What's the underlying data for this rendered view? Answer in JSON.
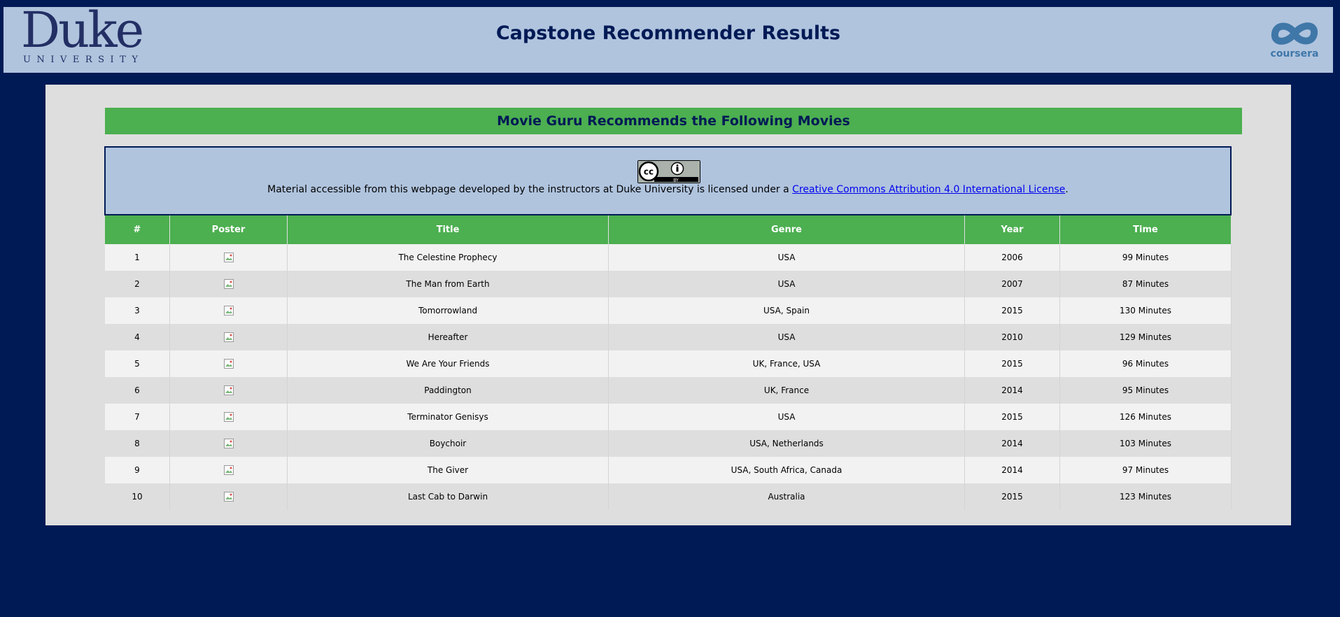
{
  "header": {
    "duke_wordmark": "Duke",
    "duke_sub": "UNIVERSITY",
    "title": "Capstone Recommender Results",
    "coursera_wordmark": "coursera"
  },
  "banner": {
    "text": "Movie Guru Recommends the Following Movies"
  },
  "license": {
    "badge": "cc-by-badge",
    "text_before": "Material accessible from this webpage developed by the instructors at Duke University is licensed under a ",
    "link_text": "Creative Commons Attribution 4.0 International License",
    "text_after": "."
  },
  "table": {
    "columns": [
      "#",
      "Poster",
      "Title",
      "Genre",
      "Year",
      "Time"
    ],
    "rows": [
      {
        "num": "1",
        "title": "The Celestine Prophecy",
        "genre": "USA",
        "year": "2006",
        "time": "99 Minutes"
      },
      {
        "num": "2",
        "title": "The Man from Earth",
        "genre": "USA",
        "year": "2007",
        "time": "87 Minutes"
      },
      {
        "num": "3",
        "title": "Tomorrowland",
        "genre": "USA, Spain",
        "year": "2015",
        "time": "130 Minutes"
      },
      {
        "num": "4",
        "title": "Hereafter",
        "genre": "USA",
        "year": "2010",
        "time": "129 Minutes"
      },
      {
        "num": "5",
        "title": "We Are Your Friends",
        "genre": "UK, France, USA",
        "year": "2015",
        "time": "96 Minutes"
      },
      {
        "num": "6",
        "title": "Paddington",
        "genre": "UK, France",
        "year": "2014",
        "time": "95 Minutes"
      },
      {
        "num": "7",
        "title": "Terminator Genisys",
        "genre": "USA",
        "year": "2015",
        "time": "126 Minutes"
      },
      {
        "num": "8",
        "title": "Boychoir",
        "genre": "USA, Netherlands",
        "year": "2014",
        "time": "103 Minutes"
      },
      {
        "num": "9",
        "title": "The Giver",
        "genre": "USA, South Africa, Canada",
        "year": "2014",
        "time": "97 Minutes"
      },
      {
        "num": "10",
        "title": "Last Cab to Darwin",
        "genre": "Australia",
        "year": "2015",
        "time": "123 Minutes"
      }
    ]
  },
  "colors": {
    "page_bg": "#001a55",
    "header_bg": "#b0c4de",
    "accent_green": "#4caf50",
    "content_bg": "#dedede"
  }
}
